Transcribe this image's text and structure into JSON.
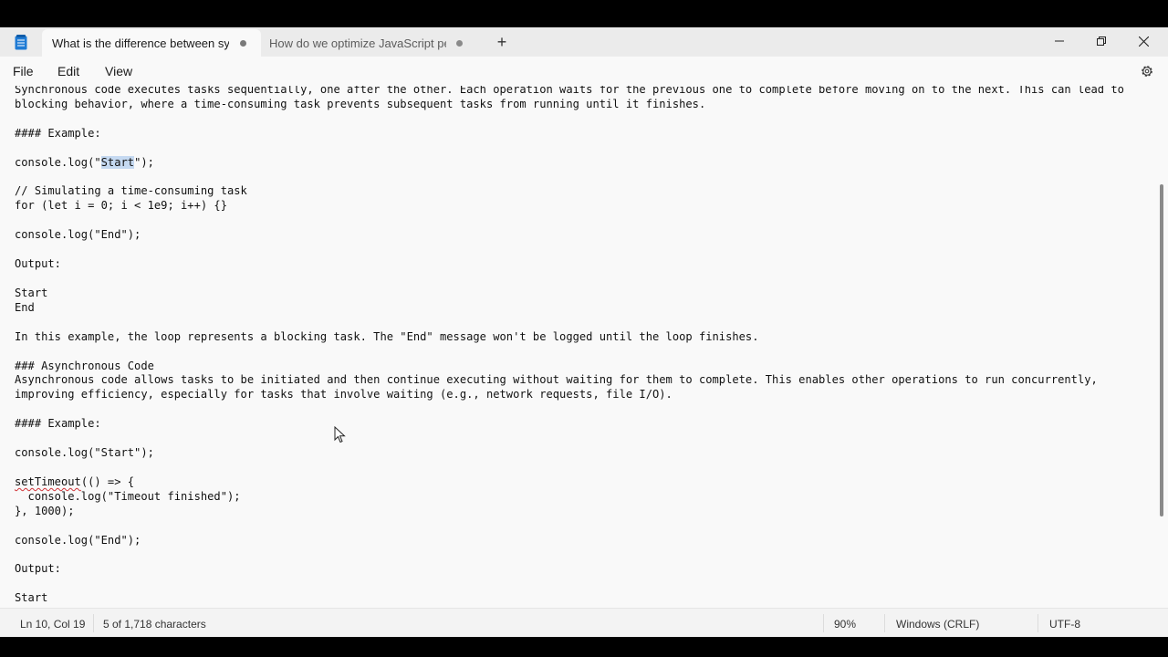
{
  "tabs": [
    {
      "title": "What is the difference between syr",
      "active": true
    },
    {
      "title": "How do we optimize JavaScript perf",
      "active": false
    }
  ],
  "new_tab_label": "+",
  "menu": {
    "file": "File",
    "edit": "Edit",
    "view": "View"
  },
  "editor": {
    "lines": [
      "Synchronous code executes tasks sequentially, one after the other. Each operation waits for the previous one to complete before moving on to the next. This can lead to",
      "blocking behavior, where a time-consuming task prevents subsequent tasks from running until it finishes.",
      "",
      "#### Example:",
      "",
      "console.log(\"Start\");",
      "",
      "// Simulating a time-consuming task",
      "for (let i = 0; i < 1e9; i++) {}",
      "",
      "console.log(\"End\");",
      "",
      "Output:",
      "",
      "Start",
      "End",
      "",
      "In this example, the loop represents a blocking task. The \"End\" message won't be logged until the loop finishes.",
      "",
      "### Asynchronous Code",
      "Asynchronous code allows tasks to be initiated and then continue executing without waiting for them to complete. This enables other operations to run concurrently,",
      "improving efficiency, especially for tasks that involve waiting (e.g., network requests, file I/O).",
      "",
      "#### Example:",
      "",
      "console.log(\"Start\");",
      "",
      "setTimeout(() => {",
      "  console.log(\"Timeout finished\");",
      "}, 1000);",
      "",
      "console.log(\"End\");",
      "",
      "Output:",
      "",
      "Start"
    ],
    "selection": {
      "line": 5,
      "text": "Start",
      "before": "console.log(\"",
      "after": "\");"
    },
    "spellcheck": {
      "line": 27,
      "word": "setTimeout",
      "rest": "(() => {"
    }
  },
  "status": {
    "position": "Ln 10, Col 19",
    "selection": "5 of 1,718 characters",
    "zoom": "90%",
    "line_ending": "Windows (CRLF)",
    "encoding": "UTF-8"
  }
}
